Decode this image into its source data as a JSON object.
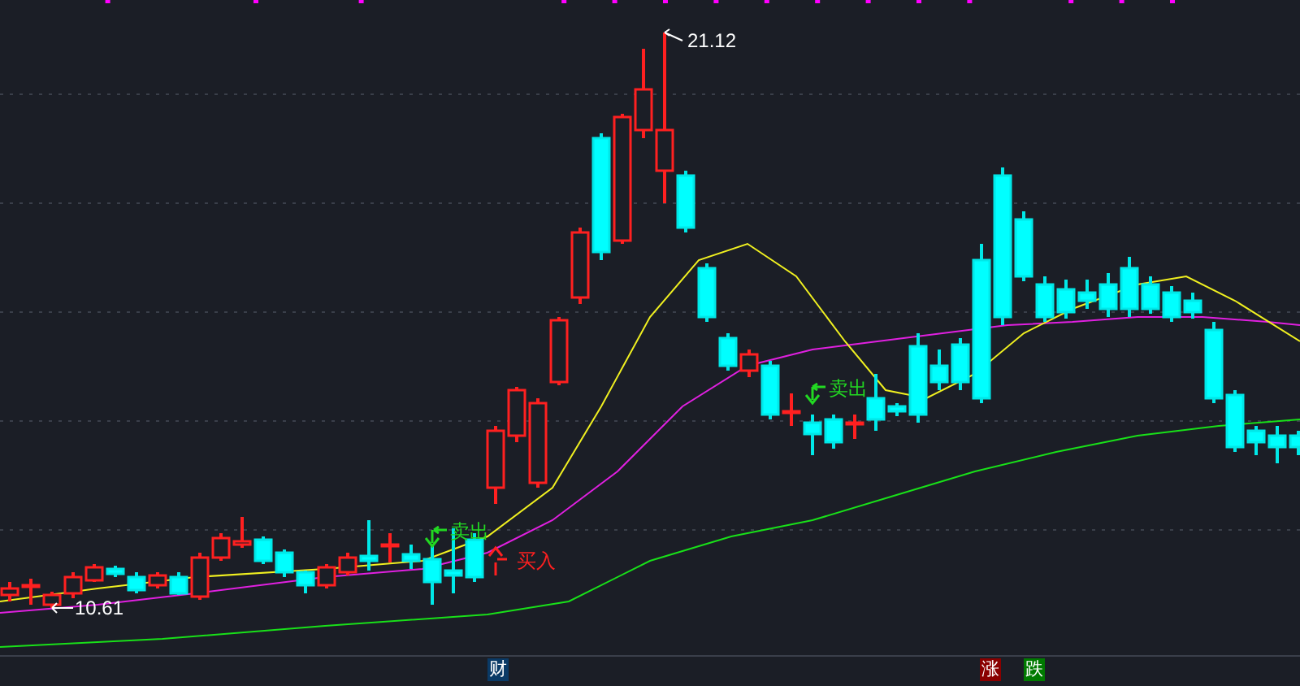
{
  "chart": {
    "high_label": "21.12",
    "low_label": "10.61",
    "signals": [
      {
        "kind": "sell",
        "label": "卖出"
      },
      {
        "kind": "sell",
        "label": "卖出"
      },
      {
        "kind": "buy",
        "label": "买入"
      }
    ]
  },
  "bottom_axis": {
    "markers": [
      {
        "kind": "finance",
        "label": "财"
      },
      {
        "kind": "rise",
        "label": "涨"
      },
      {
        "kind": "fall",
        "label": "跌"
      }
    ]
  }
}
